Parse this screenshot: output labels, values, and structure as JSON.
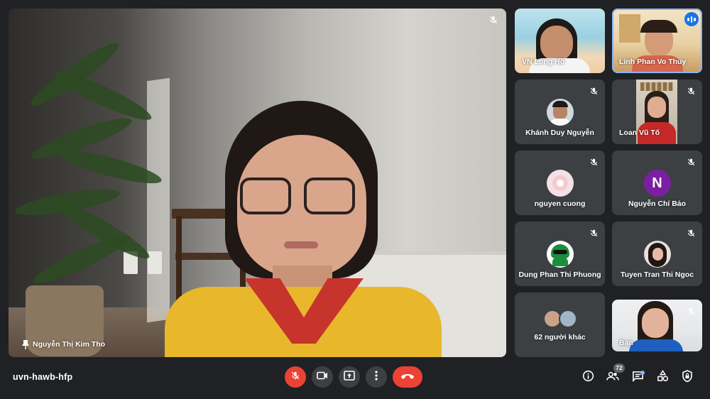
{
  "meeting": {
    "code": "uvn-hawb-hfp"
  },
  "main_speaker": {
    "name": "Nguyễn Thị Kim Tho",
    "pinned": true,
    "muted": true
  },
  "participants": [
    {
      "name": "VN Long Hồ",
      "type": "video"
    },
    {
      "name": "Linh Phan Vo Thuy",
      "type": "video",
      "speaking": true
    },
    {
      "name": "Khánh Duy Nguyễn",
      "type": "photo",
      "muted": true
    },
    {
      "name": "Loan Vũ Tố",
      "type": "video",
      "muted": true
    },
    {
      "name": "nguyen cuong",
      "type": "photo",
      "muted": true
    },
    {
      "name": "Nguyễn Chí Bảo",
      "type": "initial",
      "initial": "N",
      "color": "#7b1fa2",
      "muted": true
    },
    {
      "name": "Dung Phan Thi Phuong",
      "type": "photo",
      "muted": true
    },
    {
      "name": "Tuyen Tran Thi Ngoc",
      "type": "photo",
      "muted": true
    },
    {
      "name": "62 người khác",
      "type": "others"
    },
    {
      "name": "Bạn",
      "type": "video",
      "muted": true
    }
  ],
  "controls": {
    "mic": "mic-off-icon",
    "camera": "videocam-icon",
    "present": "present-screen-icon",
    "more": "more-vert-icon",
    "leave": "call-end-icon"
  },
  "right_panel": {
    "people_count": "72"
  },
  "colors": {
    "background": "#202124",
    "tile": "#3c4043",
    "danger": "#ea4335",
    "accent": "#8ab4f8"
  }
}
